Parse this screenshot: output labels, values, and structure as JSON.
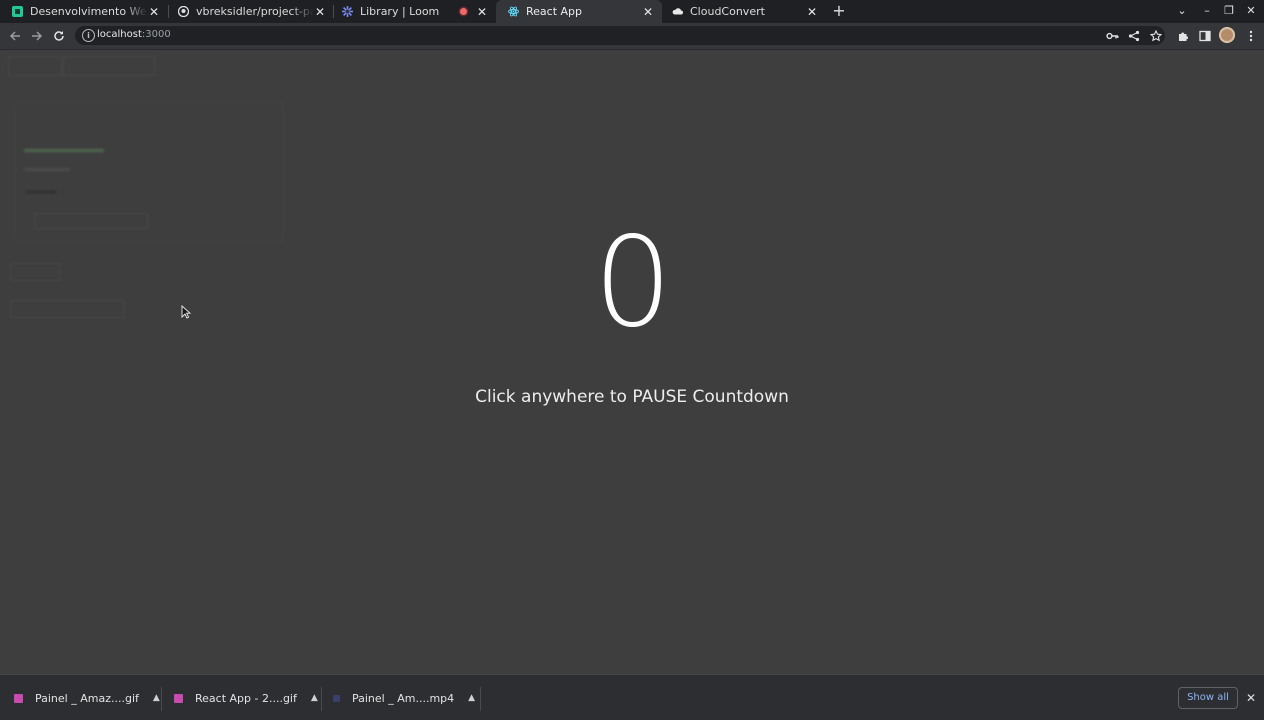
{
  "tabs": [
    {
      "title": "Desenvolvimento Web - T",
      "icon": "app-icon",
      "active": false
    },
    {
      "title": "vbreksidler/project-patie",
      "icon": "github-icon",
      "active": false
    },
    {
      "title": "Library | Loom",
      "icon": "loom-icon",
      "active": false
    },
    {
      "title": "React App",
      "icon": "react-icon",
      "active": true
    },
    {
      "title": "CloudConvert",
      "icon": "cloud-icon",
      "active": false
    }
  ],
  "address_bar": {
    "host": "localhost",
    "port": ":3000"
  },
  "page": {
    "counter": "0",
    "hint": "Click anywhere to PAUSE Countdown"
  },
  "downloads": [
    {
      "name": "Painel _ Amaz....gif"
    },
    {
      "name": "React App - 2....gif"
    },
    {
      "name": "Painel _ Am....mp4"
    }
  ],
  "show_all_label": "Show all",
  "colors": {
    "page_bg": "#3e3e3e",
    "accent_link": "#8ab4f8",
    "counter_text": "#ffffff"
  }
}
